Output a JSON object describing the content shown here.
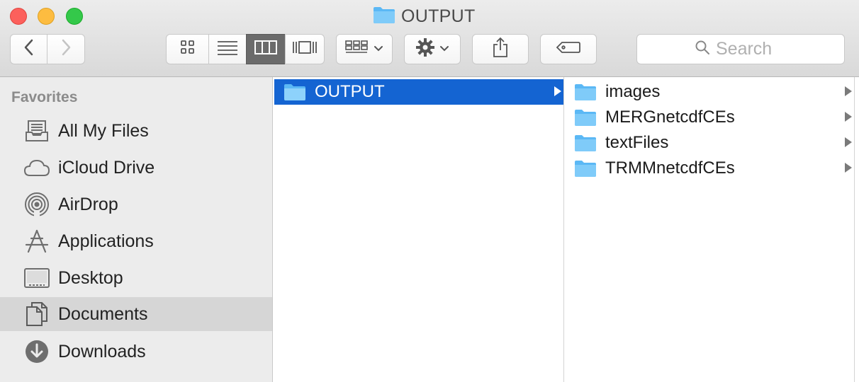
{
  "window": {
    "title": "OUTPUT"
  },
  "toolbar": {
    "search_placeholder": "Search",
    "view_mode_selected": "column"
  },
  "sidebar": {
    "section": "Favorites",
    "items": [
      {
        "label": "All My Files",
        "icon": "all-files-icon"
      },
      {
        "label": "iCloud Drive",
        "icon": "cloud-icon"
      },
      {
        "label": "AirDrop",
        "icon": "airdrop-icon"
      },
      {
        "label": "Applications",
        "icon": "applications-icon"
      },
      {
        "label": "Desktop",
        "icon": "desktop-icon"
      },
      {
        "label": "Documents",
        "icon": "documents-icon",
        "selected": true
      },
      {
        "label": "Downloads",
        "icon": "downloads-icon"
      }
    ]
  },
  "columns": [
    {
      "items": [
        {
          "name": "OUTPUT",
          "selected": true
        }
      ]
    },
    {
      "items": [
        {
          "name": "images"
        },
        {
          "name": "MERGnetcdfCEs"
        },
        {
          "name": "textFiles"
        },
        {
          "name": "TRMMnetcdfCEs"
        }
      ]
    }
  ],
  "colors": {
    "selection": "#1464d2",
    "folder": "#5bb8f5",
    "close": "#fc605c",
    "minimize": "#fdbc40",
    "zoom": "#34c84a"
  }
}
